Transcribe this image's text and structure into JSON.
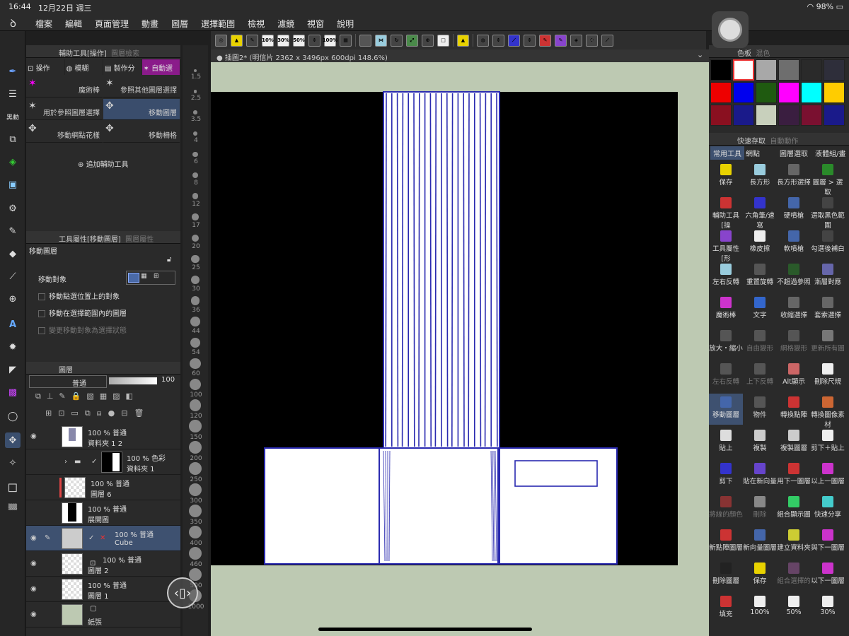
{
  "status_bar": {
    "time": "16:44",
    "date": "12月22日 週三",
    "battery": "98%"
  },
  "menu": {
    "items": [
      "檔案",
      "編輯",
      "頁面管理",
      "動畫",
      "圖層",
      "選擇範圍",
      "檢視",
      "濾鏡",
      "視窗",
      "說明"
    ]
  },
  "command_bar": {
    "labels": [
      "10%",
      "30%",
      "50%",
      "100%"
    ]
  },
  "canvas": {
    "tab_title": "插圖2* (明信片 2362 x 3496px 600dpi 148.6%)"
  },
  "sub_tool_panel": {
    "tab_active": "輔助工具[操作]",
    "tab_inactive": "圖層檢索",
    "tabs": [
      "操作",
      "模糊",
      "製作分",
      "自動選"
    ],
    "items": [
      "魔術棒",
      "參照其他圖層選擇",
      "用於參照圖層選擇",
      "移動圖層",
      "移動網點花樣",
      "移動柵格"
    ],
    "add_label": "追加輔助工具"
  },
  "tool_property": {
    "tab_active": "工具屬性[移動圖層]",
    "tab_inactive": "圖層屬性",
    "tool_name": "移動圖層",
    "move_target_label": "移動對象",
    "options": [
      "移動點選位置上的對象",
      "移動在選擇範圍內的圖層",
      "變更移動對象為選擇狀態"
    ]
  },
  "layers_panel": {
    "title": "圖層",
    "blend_mode": "普通",
    "opacity": "100",
    "layers": [
      {
        "pct": "100 % 普通",
        "name": "資料夾 1 2"
      },
      {
        "pct": "100 % 色彩",
        "name": "資料夾 1"
      },
      {
        "pct": "100 % 普通",
        "name": "圖層 6"
      },
      {
        "pct": "100 % 普通",
        "name": "展開圖"
      },
      {
        "pct": "100 % 普通",
        "name": "Cube"
      },
      {
        "pct": "100 % 普通",
        "name": "圖層 2"
      },
      {
        "pct": "100 % 普通",
        "name": "圖層 1"
      },
      {
        "pct": "",
        "name": "紙張"
      }
    ]
  },
  "ruler": {
    "marks": [
      "1.5",
      "2.5",
      "3.5",
      "4",
      "6",
      "8",
      "12",
      "17",
      "20",
      "25",
      "30",
      "36",
      "44",
      "54",
      "60",
      "100",
      "120",
      "150",
      "200",
      "250",
      "300",
      "350",
      "400",
      "460",
      "500",
      "1000"
    ]
  },
  "colors": {
    "swatches": [
      "#000000",
      "#ffffff",
      "#a8a8a8",
      "#6e6e6e",
      "#2a2a2a",
      "#2e2e3a",
      "#ee0000",
      "#0000ee",
      "#1f5a10",
      "#ff00ff",
      "#00ffff",
      "#ffcc00",
      "#8a1020",
      "#1a1a8a",
      "#c8d0bc",
      "#3a1e40",
      "#7a1030",
      "#1a1a8a"
    ],
    "accent": "#3e5170",
    "canvas_bg": "#bdc9b2",
    "stroke": "#2a2ab0"
  },
  "right_panel": {
    "palette_tab": "色板",
    "palette_tab2": "混色",
    "quick_tab": "快速存取",
    "quick_tab2": "自動動作",
    "set_tabs": [
      "常用工具",
      "網點",
      "圖層選取",
      "液體組/畫"
    ],
    "actions": [
      "保存",
      "長方形",
      "長方形選擇",
      "圖層 > 選取",
      "輔助工具[操",
      "六角筆/速寫",
      "硬噴槍",
      "選取黑色範圍",
      "工具屬性[形",
      "橡皮擦",
      "軟噴槍",
      "勾選後補白",
      "左右反轉",
      "重置旋轉",
      "不超過參照",
      "漸層對應",
      "魔術棒",
      "文字",
      "收縮選擇",
      "套索選擇",
      "放大・縮小",
      "自由變形",
      "網格變形",
      "更新所有圖",
      "左右反轉",
      "上下反轉",
      "Alt顯示",
      "刪除尺規",
      "移動圖層",
      "物件",
      "轉換點陣",
      "轉換圖像素材",
      "貼上",
      "複製",
      "複製圖層",
      "剪下＋貼上",
      "剪下",
      "貼在新向量",
      "用下一圖層",
      "以上一圖層",
      "將線的顏色",
      "刪除",
      "組合顯示圖",
      "快速分享",
      "新點陣圖層",
      "新向量圖層",
      "建立資料夾",
      "與下一圖層",
      "刪除圖層",
      "保存",
      "組合選擇的",
      "以下一圖層",
      "填充",
      "100%",
      "50%",
      "30%"
    ]
  }
}
